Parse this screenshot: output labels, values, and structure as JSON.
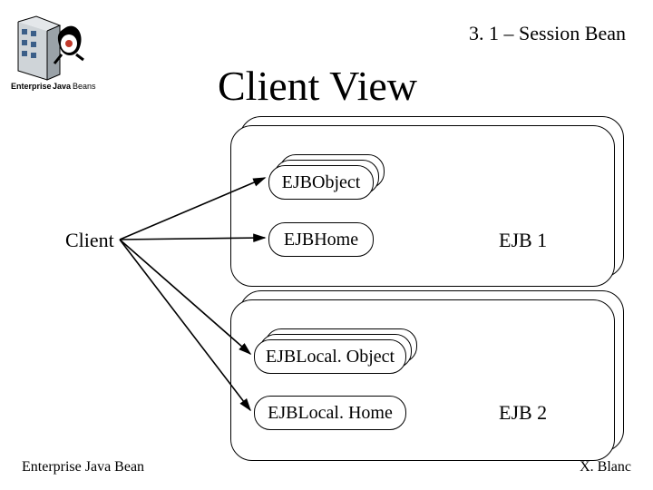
{
  "header": {
    "section": "3. 1 – Session Bean"
  },
  "title": "Client View",
  "client_label": "Client",
  "footer": {
    "left": "Enterprise Java Bean",
    "right": "X. Blanc"
  },
  "boxes": {
    "ejb_object": "EJBObject",
    "ejb_home": "EJBHome",
    "ejb_local_object": "EJBLocal. Object",
    "ejb_local_home": "EJBLocal. Home"
  },
  "ejbs": {
    "ejb1": "EJB 1",
    "ejb2": "EJB 2"
  },
  "logo": {
    "caption": "Enterprise JavaBeans"
  }
}
